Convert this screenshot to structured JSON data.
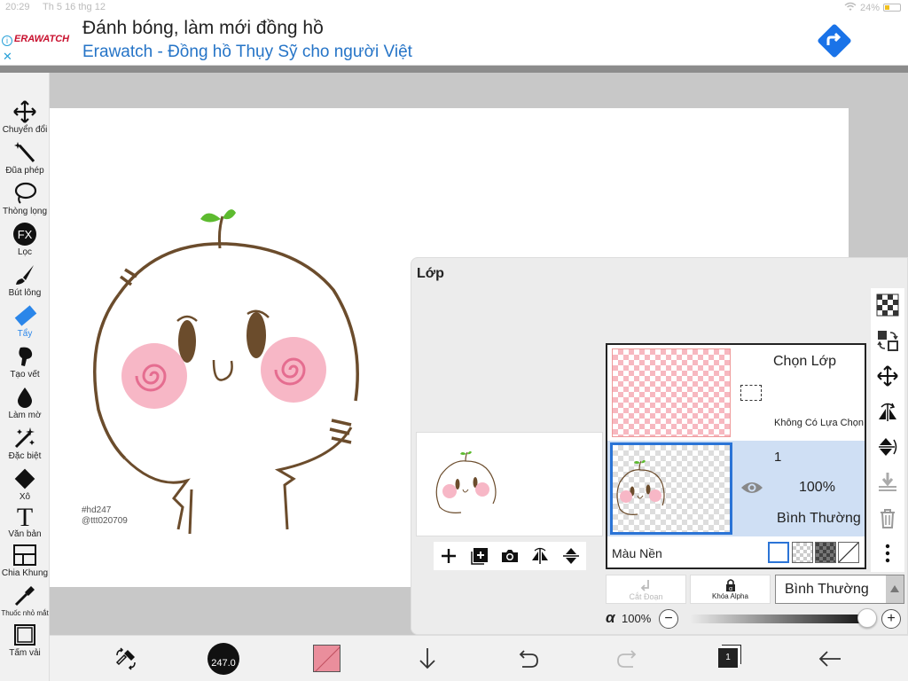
{
  "statusbar": {
    "time": "20:29",
    "date": "Th 5 16 thg 12",
    "battery": "24%"
  },
  "ad": {
    "brand": "ERAWATCH",
    "headline": "Đánh bóng, làm mới đồng hồ",
    "subline": "Erawatch - Đồng hồ Thụy Sỹ cho người Việt"
  },
  "tools": [
    {
      "label": "Chuyển đổi"
    },
    {
      "label": "Đũa phép"
    },
    {
      "label": "Thòng lọng"
    },
    {
      "label": "Lọc",
      "icon_text": "FX"
    },
    {
      "label": "Bút lông"
    },
    {
      "label": "Tẩy",
      "active": true
    },
    {
      "label": "Tạo vết"
    },
    {
      "label": "Làm mờ"
    },
    {
      "label": "Đặc biệt"
    },
    {
      "label": "Xô"
    },
    {
      "label": "Văn bản",
      "icon_text": "T"
    },
    {
      "label": "Chia Khung"
    },
    {
      "label": "Thuốc nhỏ mắt"
    },
    {
      "label": "Tấm vải"
    }
  ],
  "canvas": {
    "signature_line1": "#hd247",
    "signature_line2": "@ttt020709"
  },
  "layers_panel": {
    "title": "Lớp",
    "selection_layer": {
      "name": "Chọn Lớp",
      "status": "Không Có Lựa Chọn"
    },
    "layer": {
      "number": "1",
      "opacity": "100%",
      "blend": "Bình Thường"
    },
    "background_label": "Màu Nền",
    "cut_label": "Cắt Đoạn",
    "alpha_lock_label": "Khóa Alpha",
    "blend_mode": "Bình Thường",
    "alpha_symbol": "α",
    "alpha_value": "100%",
    "alpha_fraction": 1.0
  },
  "bottombar": {
    "brush_size": "247.0",
    "layer_count": "1"
  },
  "colors": {
    "accent": "#2b86e9",
    "selected_layer_bg": "#cfdff4",
    "current_color": "#ea8e9c"
  }
}
